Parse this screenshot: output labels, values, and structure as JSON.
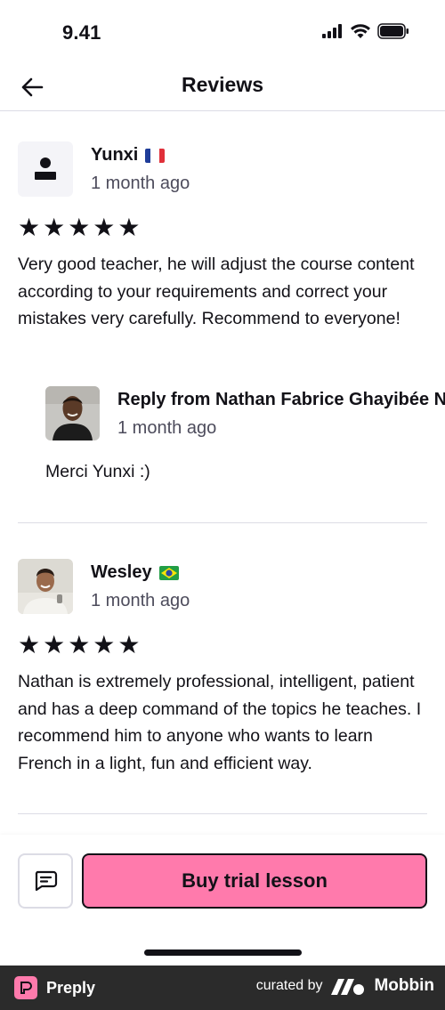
{
  "status_bar": {
    "time": "9.41"
  },
  "header": {
    "title": "Reviews",
    "back_icon": "arrow-left-icon"
  },
  "reviews": [
    {
      "name": "Yunxi",
      "flag": "france-flag",
      "date": "1 month ago",
      "stars": "★★★★★",
      "rating": 5,
      "text": "Very good teacher, he will adjust the course content according to your requirements and correct your mistakes very carefully. Recommend to everyone!",
      "reply": {
        "title": "Reply from Nathan Fabrice Ghayibée N.",
        "date": "1 month ago",
        "text": "Merci Yunxi :)"
      }
    },
    {
      "name": "Wesley",
      "flag": "brazil-flag",
      "date": "1 month ago",
      "stars": "★★★★★",
      "rating": 5,
      "text": "Nathan is extremely professional, intelligent, patient and has a deep command of the topics he teaches. I recommend him to anyone who wants to learn French in a light, fun and efficient way."
    }
  ],
  "bottom_bar": {
    "message_icon": "message-icon",
    "trial_button": "Buy trial lesson"
  },
  "footer": {
    "brand": "Preply",
    "curated_by": "curated by",
    "curator": "Mobbin"
  },
  "colors": {
    "accent_pink": "#ff7aac",
    "text_primary": "#121117",
    "text_secondary": "#4d4c5c",
    "divider": "#dcdce5",
    "footer_bg": "#2b2b2b"
  }
}
